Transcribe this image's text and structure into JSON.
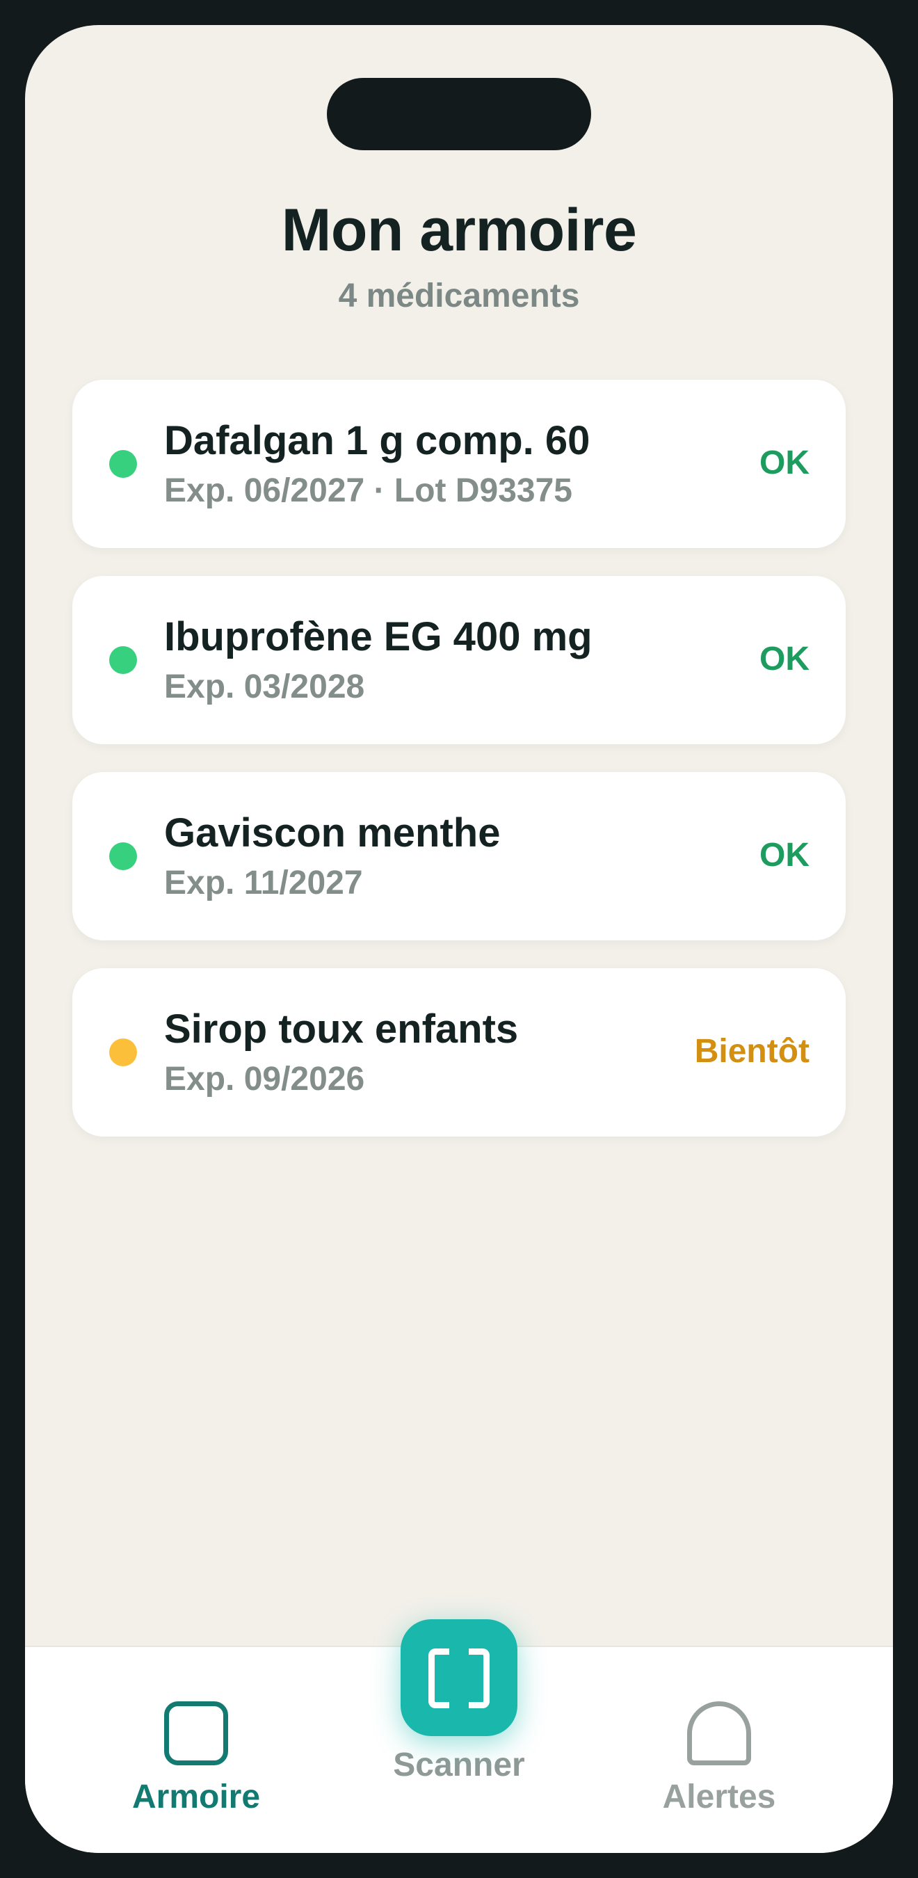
{
  "header": {
    "title": "Mon armoire",
    "subtitle": "4 médicaments"
  },
  "medications": [
    {
      "name": "Dafalgan 1 g comp. 60",
      "meta": "Exp. 06/2027 · Lot D93375",
      "status": "OK",
      "dot_color": "#37d07e",
      "status_color": "#1e9b5e"
    },
    {
      "name": "Ibuprofène EG 400 mg",
      "meta": "Exp. 03/2028",
      "status": "OK",
      "dot_color": "#37d07e",
      "status_color": "#1e9b5e"
    },
    {
      "name": "Gaviscon menthe",
      "meta": "Exp. 11/2027",
      "status": "OK",
      "dot_color": "#37d07e",
      "status_color": "#1e9b5e"
    },
    {
      "name": "Sirop toux enfants",
      "meta": "Exp. 09/2026",
      "status": "Bientôt",
      "dot_color": "#fbbf3a",
      "status_color": "#d38f12"
    }
  ],
  "tabbar": {
    "armoire": {
      "label": "Armoire",
      "icon": "cabinet-icon",
      "active": true
    },
    "scanner": {
      "label": "Scanner",
      "icon": "scan-icon"
    },
    "alertes": {
      "label": "Alertes",
      "icon": "bell-icon"
    }
  },
  "colors": {
    "accent": "#19b7ac",
    "active_tab": "#137a72",
    "background": "#f3f0ea"
  }
}
